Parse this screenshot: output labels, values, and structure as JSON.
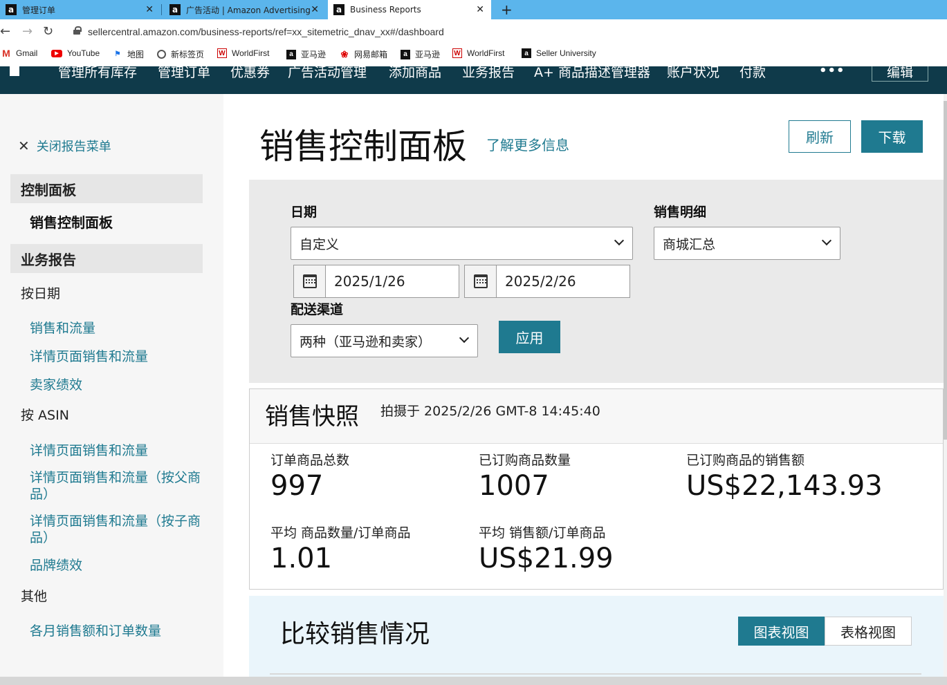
{
  "browser": {
    "tabs": [
      {
        "favicon": "a",
        "title": "管理订单",
        "close": "✕"
      },
      {
        "favicon": "a",
        "title": "广告活动 | Amazon Advertising",
        "close": "✕"
      },
      {
        "favicon": "a",
        "title": "Business Reports",
        "close": "✕"
      }
    ],
    "new_tab": "+",
    "url": "sellercentral.amazon.com/business-reports/ref=xx_sitemetric_dnav_xx#/dashboard",
    "bookmarks": [
      {
        "icon": "gmail-icon",
        "label": "Gmail"
      },
      {
        "icon": "youtube-icon",
        "label": "YouTube"
      },
      {
        "icon": "maps-icon",
        "label": "地图"
      },
      {
        "icon": "globe-icon",
        "label": "新标签页"
      },
      {
        "icon": "worldfirst-icon",
        "label": "WorldFirst"
      },
      {
        "icon": "amazon-icon",
        "label": "亚马逊"
      },
      {
        "icon": "mail163-icon",
        "label": "网易邮箱"
      },
      {
        "icon": "amazon-icon",
        "label": "亚马逊"
      },
      {
        "icon": "worldfirst-icon",
        "label": "WorldFirst"
      },
      {
        "icon": "amazon-icon",
        "label": "Seller University"
      }
    ]
  },
  "topnav": {
    "items": [
      "管理所有库存",
      "管理订单",
      "优惠券",
      "广告活动管理",
      "添加商品",
      "业务报告",
      "A+ 商品描述管理器",
      "账户状况",
      "付款"
    ],
    "more": "•••",
    "edit": "编辑"
  },
  "sidebar": {
    "close_label": "关闭报告菜单",
    "dashboard_head": "控制面板",
    "dashboard_sub": "销售控制面板",
    "reports_head": "业务报告",
    "by_date": "按日期",
    "by_date_links": [
      "销售和流量",
      "详情页面销售和流量",
      "卖家绩效"
    ],
    "by_asin": "按 ASIN",
    "by_asin_links": [
      "详情页面销售和流量",
      "详情页面销售和流量（按父商品）",
      "详情页面销售和流量（按子商品）",
      "品牌绩效"
    ],
    "other": "其他",
    "other_links": [
      "各月销售额和订单数量"
    ]
  },
  "main": {
    "title": "销售控制面板",
    "learn_more": "了解更多信息",
    "refresh": "刷新",
    "download": "下载",
    "filters": {
      "date_label": "日期",
      "date_value": "自定义",
      "start_date": "2025/1/26",
      "end_date": "2025/2/26",
      "breakdown_label": "销售明细",
      "breakdown_value": "商城汇总",
      "channel_label": "配送渠道",
      "channel_value": "两种（亚马逊和卖家）",
      "apply": "应用"
    },
    "snapshot": {
      "title": "销售快照",
      "taken_at": "拍摄于 2025/2/26 GMT-8 14:45:40",
      "metrics": [
        {
          "label": "订单商品总数",
          "value": "997"
        },
        {
          "label": "已订购商品数量",
          "value": "1007"
        },
        {
          "label": "已订购商品的销售额",
          "value": "US$22,143.93"
        },
        {
          "label": "平均 商品数量/订单商品",
          "value": "1.01"
        },
        {
          "label": "平均 销售额/订单商品",
          "value": "US$21.99"
        }
      ]
    },
    "compare": {
      "title": "比较销售情况",
      "chart_view": "图表视图",
      "table_view": "表格视图"
    }
  },
  "colors": {
    "accent": "#1f7a90",
    "nav_bg": "#0f3a4a",
    "tabstrip": "#5bb5ec"
  }
}
